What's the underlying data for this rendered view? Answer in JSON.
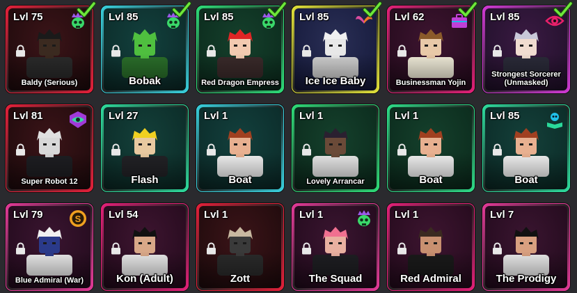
{
  "units": [
    {
      "level": "Lvl 75",
      "name": "Baldy (Serious)",
      "frame": "#e8203a",
      "bg": [
        "#3b1418",
        "#1e0a0c"
      ],
      "trait": "skull-crown-icon",
      "trait_color": "#9b59e8",
      "equipped": true,
      "skin": "#3b2a20",
      "hair": "#1a1a1a",
      "cloth": "#2a2a2a",
      "name_size": "small"
    },
    {
      "level": "Lvl 85",
      "name": "Bobak",
      "frame": "#39d3e0",
      "bg": [
        "#13403d",
        "#0b2a28"
      ],
      "trait": "skull-crown-icon",
      "trait_color": "#9b59e8",
      "equipped": true,
      "skin": "#4fbf3f",
      "hair": "#4fbf3f",
      "cloth": "#2a6e2a",
      "name_size": "normal"
    },
    {
      "level": "Lvl 85",
      "name": "Red Dragon Empress",
      "frame": "#2ee07a",
      "bg": [
        "#15402c",
        "#0b2a1c"
      ],
      "trait": "skull-crown-icon",
      "trait_color": "#9b59e8",
      "equipped": true,
      "skin": "#f2c9b0",
      "hair": "#e02525",
      "cloth": "#3a2a2a",
      "name_size": "small"
    },
    {
      "level": "Lvl 85",
      "name": "Ice Ice Baby",
      "frame": "#e6e63a",
      "bg": [
        "#2a2f55",
        "#14183a"
      ],
      "trait": "wings-icon",
      "trait_color": "#d94b9e",
      "equipped": true,
      "skin": "#e8e8e8",
      "hair": "#f0f0f0",
      "cloth": "#cfcfcf",
      "name_size": "normal"
    },
    {
      "level": "Lvl 62",
      "name": "Businessman Yojin",
      "frame": "#e8207a",
      "bg": [
        "#3d1530",
        "#240a1c"
      ],
      "trait": "briefcase-icon",
      "trait_color": "#c040d8",
      "equipped": true,
      "skin": "#e8c9a8",
      "hair": "#8a5a2a",
      "cloth": "#f0ead8",
      "name_size": "small"
    },
    {
      "level": "Lvl 85",
      "name": "Strongest Sorcerer (Unmasked)",
      "frame": "#d43ad8",
      "bg": [
        "#3a1a42",
        "#20102a"
      ],
      "trait": "eye-icon",
      "trait_color": "#e8206a",
      "equipped": true,
      "skin": "#f0dcd0",
      "hair": "#c8c8d8",
      "cloth": "#2a2a38",
      "name_size": "small"
    },
    {
      "level": "Lvl 81",
      "name": "Super Robot 12",
      "frame": "#e8203a",
      "bg": [
        "#3b1418",
        "#1e0a0c"
      ],
      "trait": "all-seeing-eye-icon",
      "trait_color": "#3ad8a0",
      "equipped": false,
      "skin": "#d8d8d8",
      "hair": "#e0e0e0",
      "cloth": "#1e1e22",
      "name_size": "small"
    },
    {
      "level": "Lvl 27",
      "name": "Flash",
      "frame": "#2ee0a0",
      "bg": [
        "#14403a",
        "#0b2a26"
      ],
      "trait": "",
      "trait_color": "",
      "equipped": false,
      "skin": "#e8c9a0",
      "hair": "#f0d020",
      "cloth": "#222226",
      "name_size": "normal"
    },
    {
      "level": "Lvl 1",
      "name": "Boat",
      "frame": "#39d3e0",
      "bg": [
        "#13403d",
        "#0b2a28"
      ],
      "trait": "",
      "trait_color": "",
      "equipped": false,
      "skin": "#e8b090",
      "hair": "#a04020",
      "cloth": "#f2f2f2",
      "name_size": "normal"
    },
    {
      "level": "Lvl 1",
      "name": "Lovely Arrancar",
      "frame": "#2ee07a",
      "bg": [
        "#15402c",
        "#0b2a1c"
      ],
      "trait": "",
      "trait_color": "",
      "equipped": false,
      "skin": "#6a4a38",
      "hair": "#2a2030",
      "cloth": "#e8e8e8",
      "name_size": "small"
    },
    {
      "level": "Lvl 1",
      "name": "Boat",
      "frame": "#2ee08a",
      "bg": [
        "#15402c",
        "#0b2a1c"
      ],
      "trait": "",
      "trait_color": "",
      "equipped": false,
      "skin": "#e8b090",
      "hair": "#a04020",
      "cloth": "#f2f2f2",
      "name_size": "normal"
    },
    {
      "level": "Lvl 85",
      "name": "Boat",
      "frame": "#2ee0a0",
      "bg": [
        "#14403a",
        "#0b2a26"
      ],
      "trait": "book-skull-icon",
      "trait_color": "#20c0e8",
      "equipped": false,
      "skin": "#e8b090",
      "hair": "#a04020",
      "cloth": "#f2f2f2",
      "name_size": "normal"
    },
    {
      "level": "Lvl 79",
      "name": "Blue Admiral (War)",
      "frame": "#e83a9a",
      "bg": [
        "#3a1530",
        "#220a1c"
      ],
      "trait": "coin-badge-icon",
      "trait_color": "#f0a020",
      "equipped": false,
      "skin": "#2a3a8a",
      "hair": "#f0f0f0",
      "cloth": "#e8e8e8",
      "name_size": "small"
    },
    {
      "level": "Lvl 54",
      "name": "Kon (Adult)",
      "frame": "#e8207a",
      "bg": [
        "#3d1530",
        "#240a1c"
      ],
      "trait": "",
      "trait_color": "",
      "equipped": false,
      "skin": "#d8a888",
      "hair": "#111111",
      "cloth": "#e8e8e8",
      "name_size": "normal"
    },
    {
      "level": "Lvl 1",
      "name": "Zott",
      "frame": "#e8203a",
      "bg": [
        "#3b1418",
        "#1e0a0c"
      ],
      "trait": "",
      "trait_color": "",
      "equipped": false,
      "skin": "#3a3a3a",
      "hair": "#c8b8a0",
      "cloth": "#2a2a2a",
      "name_size": "normal"
    },
    {
      "level": "Lvl 1",
      "name": "The Squad",
      "frame": "#e83a9a",
      "bg": [
        "#3a1530",
        "#220a1c"
      ],
      "trait": "skull-crown-icon",
      "trait_color": "#9b59e8",
      "equipped": false,
      "skin": "#e8b0a0",
      "hair": "#f07090",
      "cloth": "#1e1e22",
      "name_size": "normal"
    },
    {
      "level": "Lvl 1",
      "name": "Red Admiral",
      "frame": "#e8207a",
      "bg": [
        "#3d1530",
        "#240a1c"
      ],
      "trait": "",
      "trait_color": "",
      "equipped": false,
      "skin": "#c89070",
      "hair": "#3a2a20",
      "cloth": "#1a1a1a",
      "name_size": "normal"
    },
    {
      "level": "Lvl 7",
      "name": "The Prodigy",
      "frame": "#e83a9a",
      "bg": [
        "#3a1530",
        "#220a1c"
      ],
      "trait": "",
      "trait_color": "",
      "equipped": false,
      "skin": "#d8a080",
      "hair": "#111111",
      "cloth": "#e8e8e8",
      "name_size": "normal"
    }
  ]
}
